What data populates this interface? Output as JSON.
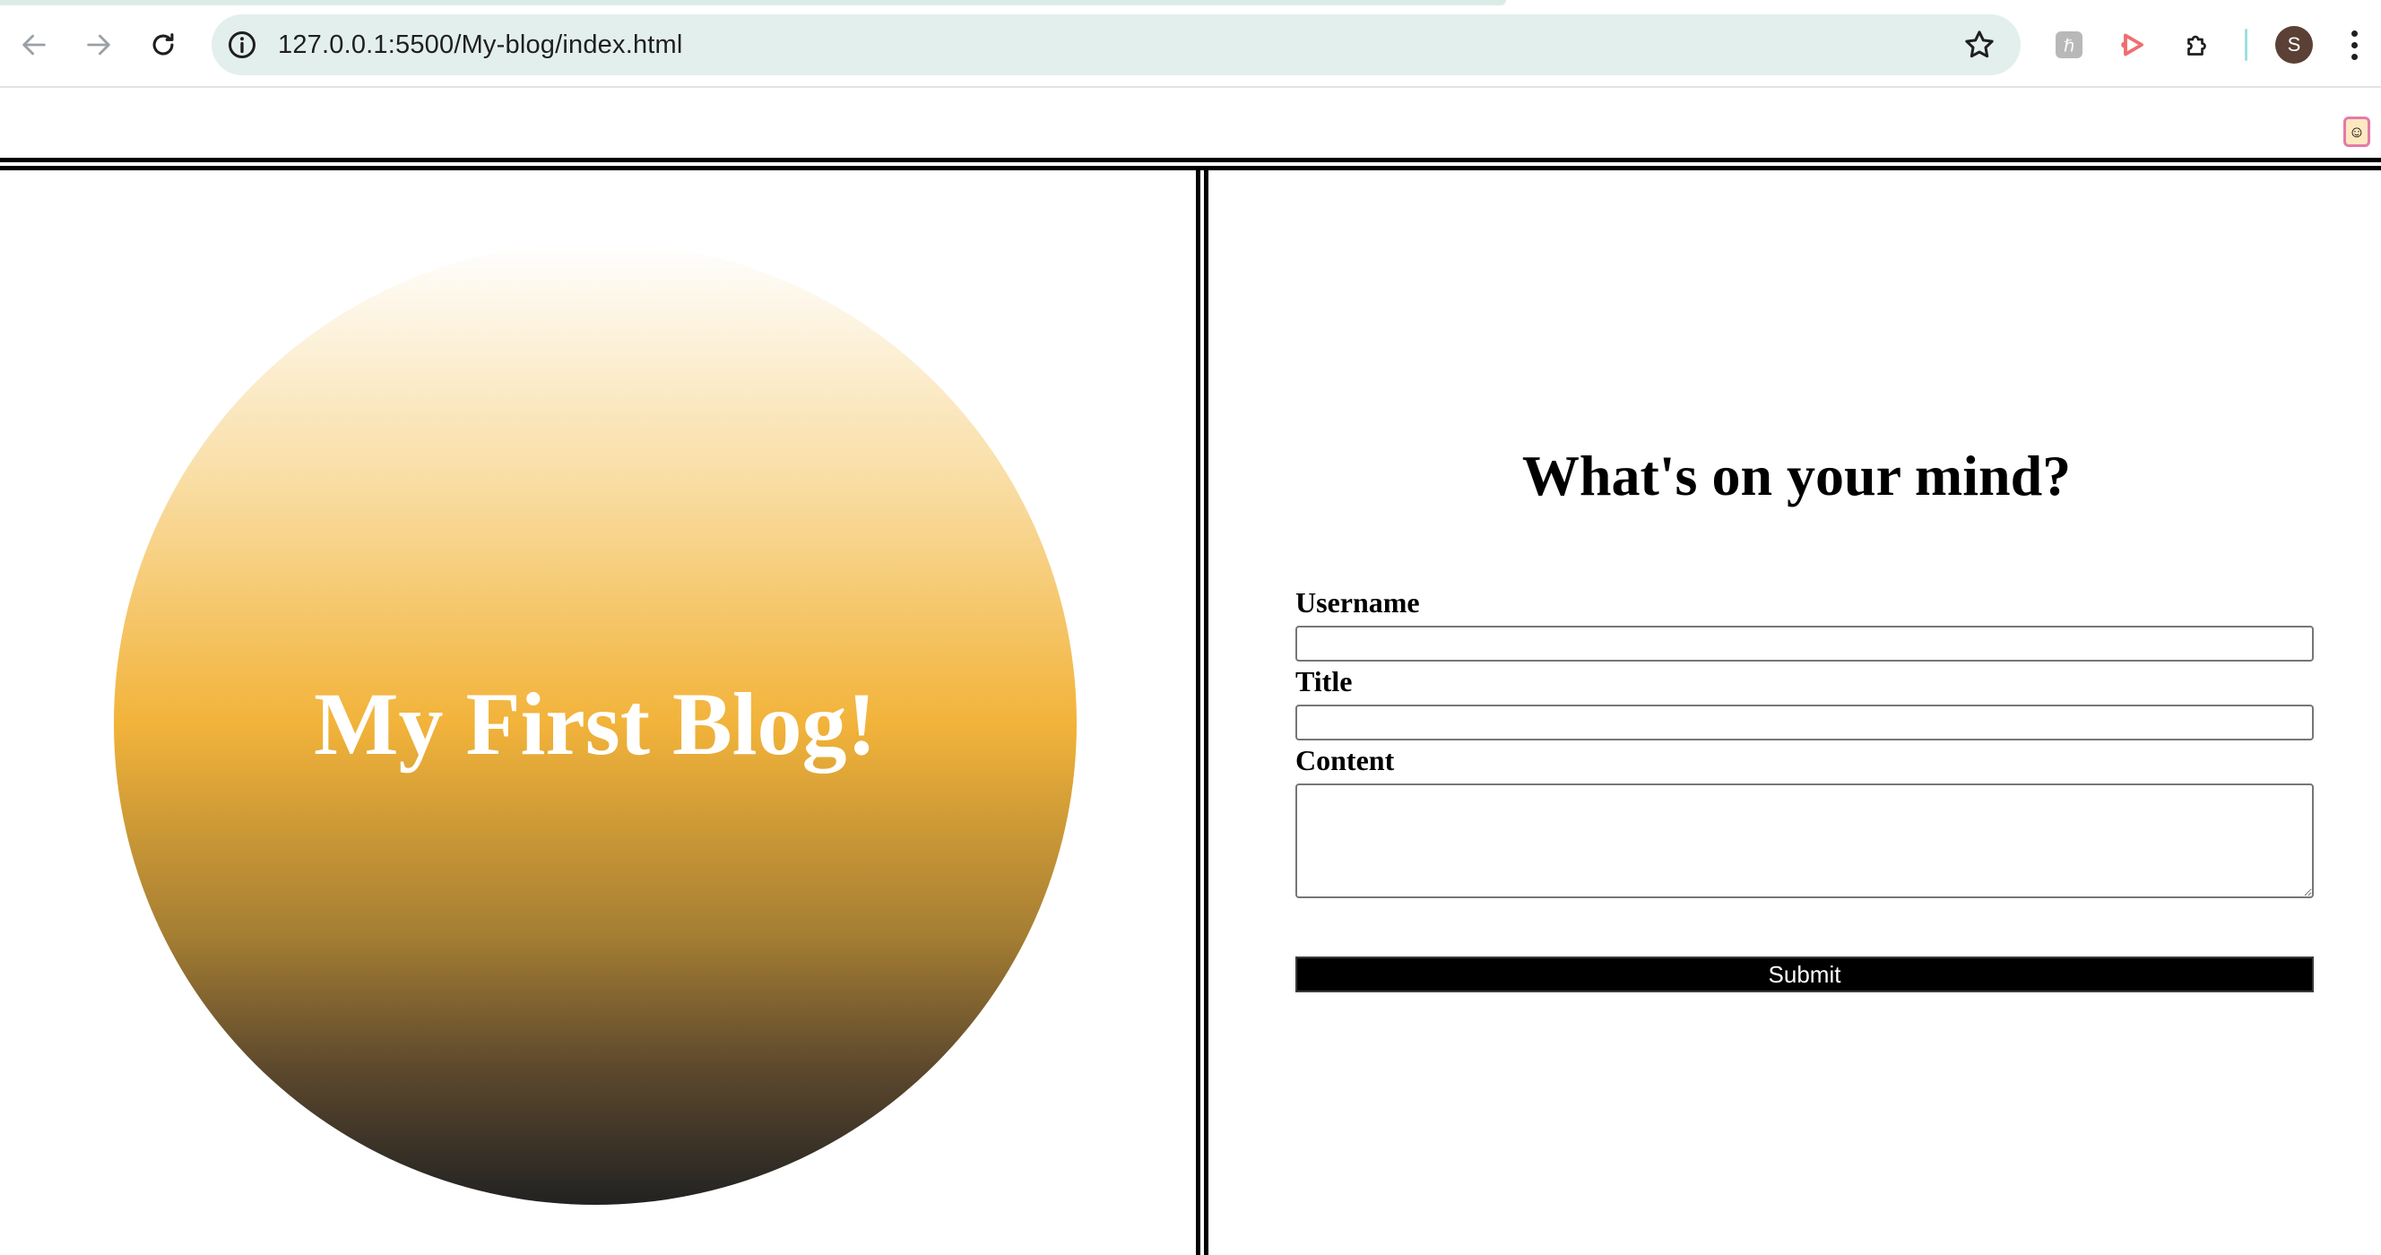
{
  "browser": {
    "url": "127.0.0.1:5500/My-blog/index.html",
    "profile_initial": "S",
    "icons": {
      "back": "arrow-left",
      "forward": "arrow-right",
      "reload": "reload",
      "site_info": "info-circle",
      "bookmark": "star-outline",
      "extension_1": "bookmark-extension",
      "extension_2": "play-extension",
      "extensions": "puzzle-piece",
      "menu": "vertical-dots",
      "side_extension": "emoji-face"
    }
  },
  "hero": {
    "title": "My First Blog!",
    "gradient_colors": [
      "#ffffff",
      "#f9dda3",
      "#f2b33a",
      "#a57e33",
      "#5c482d",
      "#222222"
    ]
  },
  "form": {
    "heading": "What's on your mind?",
    "username_label": "Username",
    "username_value": "",
    "title_label": "Title",
    "title_value": "",
    "content_label": "Content",
    "content_value": "",
    "submit_label": "Submit"
  }
}
